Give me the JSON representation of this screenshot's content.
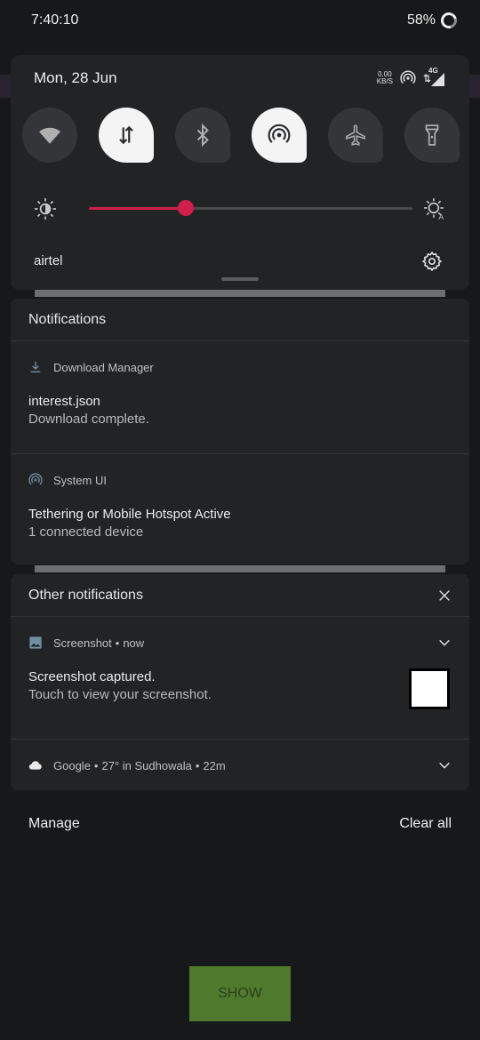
{
  "status_bar": {
    "time": "7:40:10",
    "battery": "58%"
  },
  "quick_settings": {
    "date": "Mon, 28 Jun",
    "netspeed_value": "0.00",
    "netspeed_unit": "KB/S",
    "network_type": "4G",
    "tiles": [
      {
        "icon": "wifi-icon",
        "active": false
      },
      {
        "icon": "mobile-data-icon",
        "active": true
      },
      {
        "icon": "bluetooth-icon",
        "active": false
      },
      {
        "icon": "hotspot-icon",
        "active": true
      },
      {
        "icon": "airplane-icon",
        "active": false
      },
      {
        "icon": "flashlight-icon",
        "active": false
      }
    ],
    "brightness_level": 0.3,
    "carrier": "airtel",
    "accent_color": "#d01f4a"
  },
  "notifications": {
    "header": "Notifications",
    "items": [
      {
        "app": "Download Manager",
        "title": "interest.json",
        "text": "Download complete."
      },
      {
        "app": "System UI",
        "title": "Tethering or Mobile Hotspot Active",
        "text": "1 connected device"
      }
    ]
  },
  "other_notifications": {
    "header": "Other notifications",
    "screenshot": {
      "app": "Screenshot",
      "time": "now",
      "title": "Screenshot captured.",
      "text": "Touch to view your screenshot."
    },
    "google": {
      "app": "Google",
      "info": "27° in Sudhowala",
      "time": "22m"
    }
  },
  "footer": {
    "manage": "Manage",
    "clear_all": "Clear all"
  },
  "show_button": "SHOW",
  "separator": "•"
}
